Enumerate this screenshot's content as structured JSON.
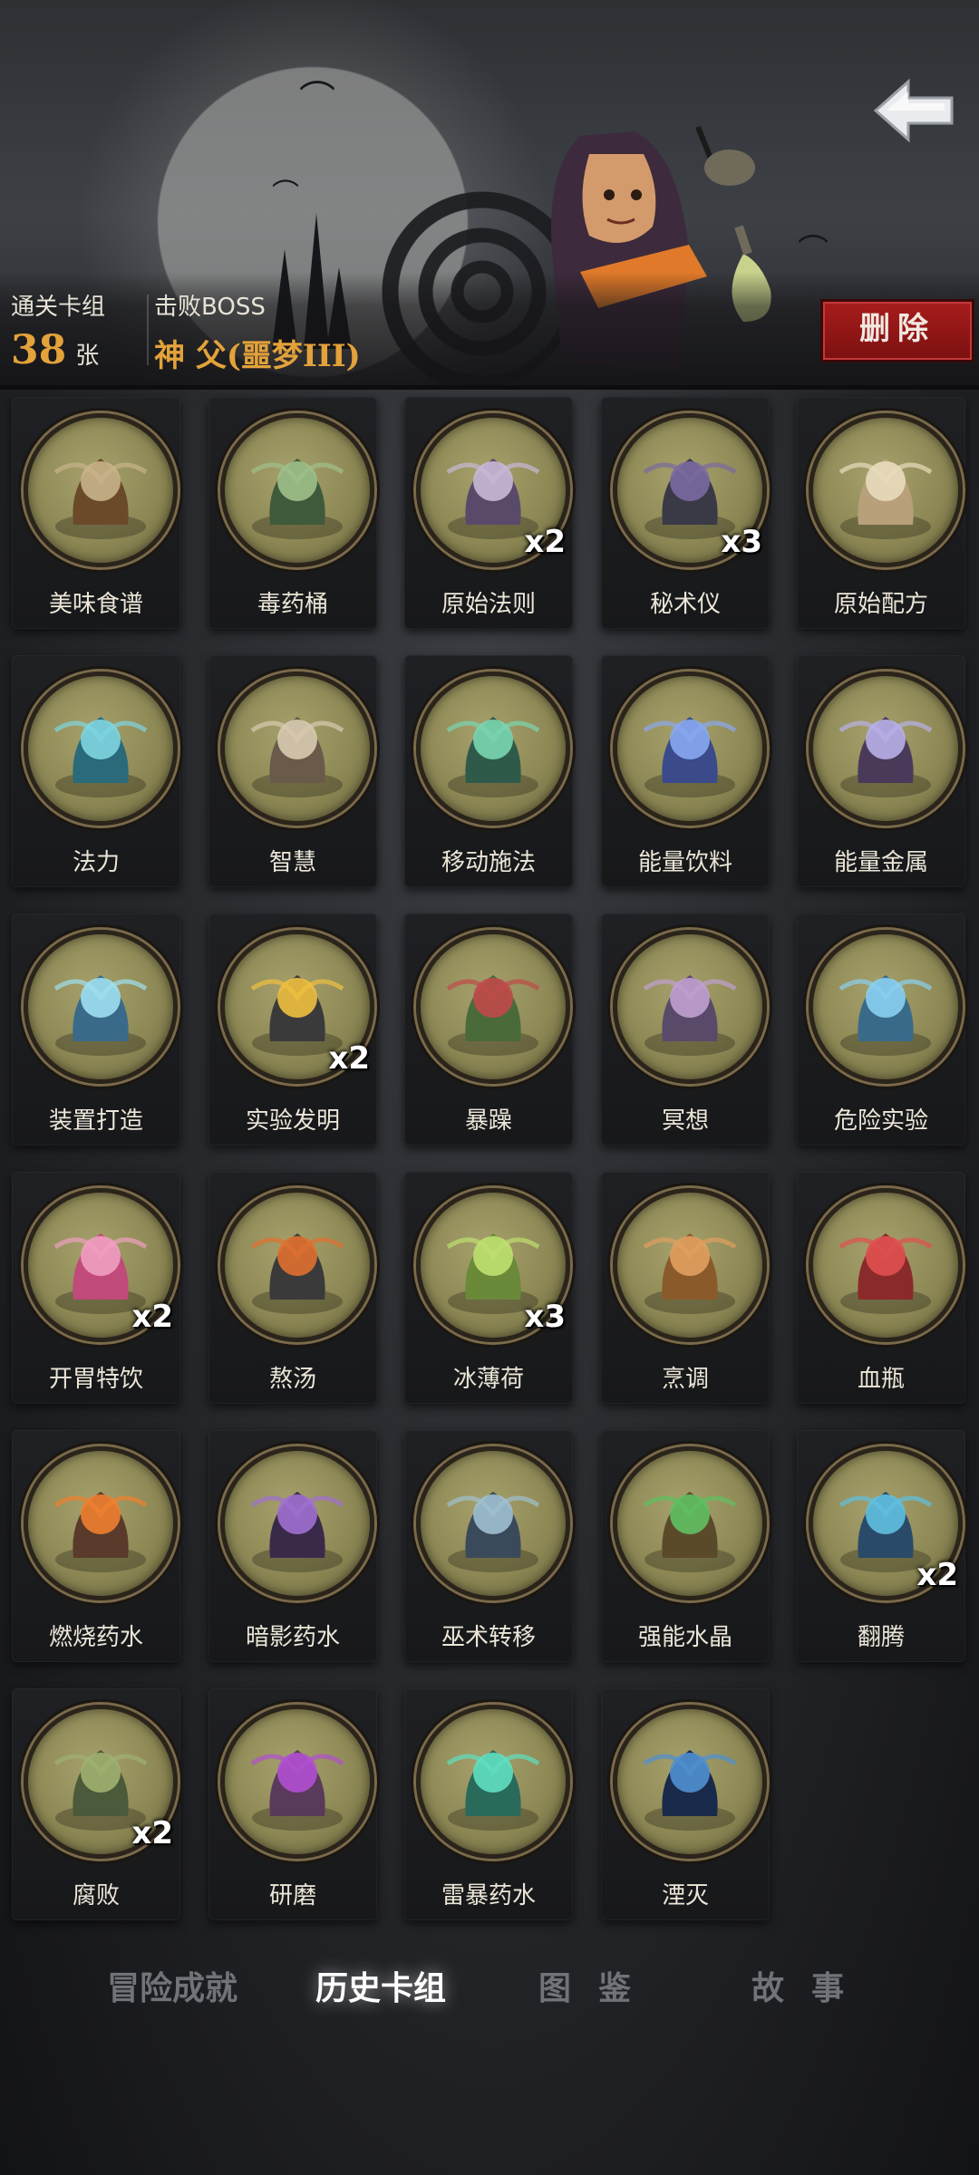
{
  "header": {
    "cleared_decks_label": "通关卡组",
    "cleared_decks_count": "38",
    "cleared_decks_unit": "张",
    "defeated_boss_label": "击败BOSS",
    "defeated_boss_name": "神 父(噩梦III)",
    "delete_label": "删除",
    "back_icon": "back-arrow-icon"
  },
  "cards": [
    {
      "name": "美味食谱",
      "mult": "",
      "icon": "recipe-book-icon"
    },
    {
      "name": "毒药桶",
      "mult": "",
      "icon": "poison-barrel-icon"
    },
    {
      "name": "原始法则",
      "mult": "x2",
      "icon": "scales-icon"
    },
    {
      "name": "秘术仪",
      "mult": "x3",
      "icon": "arcane-device-icon"
    },
    {
      "name": "原始配方",
      "mult": "",
      "icon": "scroll-icon"
    },
    {
      "name": "法力",
      "mult": "",
      "icon": "mana-orb-icon"
    },
    {
      "name": "智慧",
      "mult": "",
      "icon": "sage-icon"
    },
    {
      "name": "移动施法",
      "mult": "",
      "icon": "wizard-casting-icon"
    },
    {
      "name": "能量饮料",
      "mult": "",
      "icon": "energy-drink-icon"
    },
    {
      "name": "能量金属",
      "mult": "",
      "icon": "energy-metal-icon"
    },
    {
      "name": "装置打造",
      "mult": "",
      "icon": "device-crafting-icon"
    },
    {
      "name": "实验发明",
      "mult": "x2",
      "icon": "experiment-robot-icon"
    },
    {
      "name": "暴躁",
      "mult": "",
      "icon": "angry-ogre-icon"
    },
    {
      "name": "冥想",
      "mult": "",
      "icon": "meditation-icon"
    },
    {
      "name": "危险实验",
      "mult": "",
      "icon": "dangerous-experiment-icon"
    },
    {
      "name": "开胃特饮",
      "mult": "x2",
      "icon": "cocktail-icon"
    },
    {
      "name": "熬汤",
      "mult": "",
      "icon": "cauldron-icon"
    },
    {
      "name": "冰薄荷",
      "mult": "x3",
      "icon": "mint-drink-icon"
    },
    {
      "name": "烹调",
      "mult": "",
      "icon": "fox-chef-icon"
    },
    {
      "name": "血瓶",
      "mult": "",
      "icon": "blood-potion-icon"
    },
    {
      "name": "燃烧药水",
      "mult": "",
      "icon": "fire-potion-icon"
    },
    {
      "name": "暗影药水",
      "mult": "",
      "icon": "shadow-potion-icon"
    },
    {
      "name": "巫术转移",
      "mult": "",
      "icon": "witchcraft-transfer-icon"
    },
    {
      "name": "强能水晶",
      "mult": "",
      "icon": "power-crystal-icon"
    },
    {
      "name": "翻腾",
      "mult": "x2",
      "icon": "churning-icon"
    },
    {
      "name": "腐败",
      "mult": "x2",
      "icon": "decay-icon"
    },
    {
      "name": "研磨",
      "mult": "",
      "icon": "grinding-icon"
    },
    {
      "name": "雷暴药水",
      "mult": "",
      "icon": "thunder-potion-icon"
    },
    {
      "name": "湮灭",
      "mult": "",
      "icon": "annihilation-icon"
    }
  ],
  "tabs": [
    {
      "label": "冒险成就",
      "active": false
    },
    {
      "label": "历史卡组",
      "active": true
    },
    {
      "label": "图鉴",
      "active": false
    },
    {
      "label": "故事",
      "active": false
    }
  ],
  "colors": {
    "accent_gold": "#e3a23a",
    "delete_red": "#a81c1c",
    "card_art_olive": "#8d8855"
  }
}
